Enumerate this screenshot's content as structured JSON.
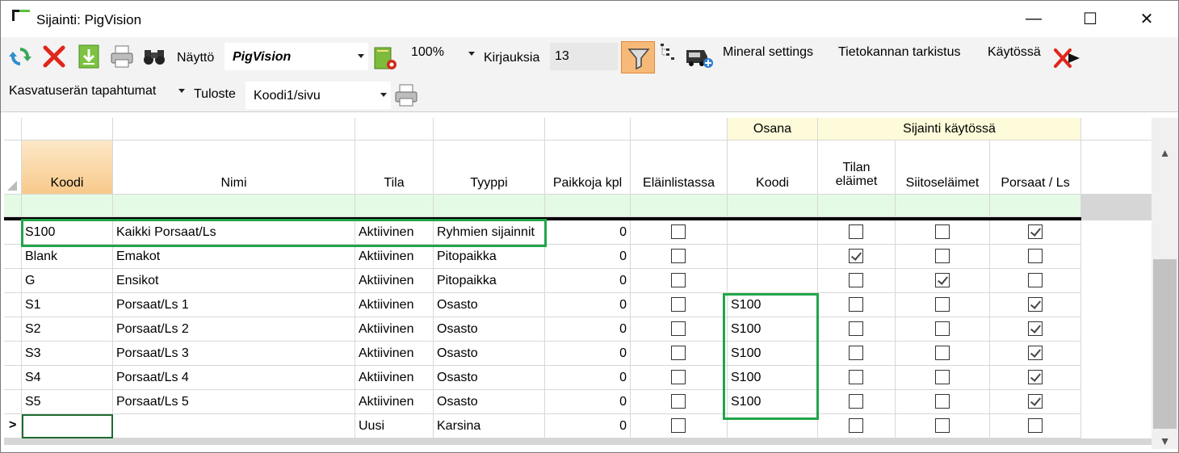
{
  "window": {
    "title": "Sijainti: PigVision",
    "minimize": "—",
    "maximize": "☐",
    "close": "✕"
  },
  "toolbar": {
    "nayto_label": "Näyttö",
    "nayto_value": "PigVision",
    "zoom_value": "100%",
    "kirjauksia_label": "Kirjauksia",
    "kirjauksia_value": "13",
    "mineral_settings": "Mineral settings",
    "tietokannan_tarkistus": "Tietokannan tarkistus",
    "kaytossa": "Käytössä",
    "kasvatuseran_tapahtumat": "Kasvatuserän tapahtumat",
    "tuloste_label": "Tuloste",
    "tuloste_value": "Koodi1/sivu"
  },
  "grid": {
    "group_headers": {
      "osana": "Osana",
      "sijainti_kaytossa": "Sijainti käytössä"
    },
    "columns": {
      "koodi": "Koodi",
      "nimi": "Nimi",
      "tila": "Tila",
      "tyyppi": "Tyyppi",
      "paikkoja": "Paikkoja kpl",
      "elainlistassa": "Eläinlistassa",
      "osana_koodi": "Koodi",
      "tilan_elaimet_1": "Tilan",
      "tilan_elaimet_2": "eläimet",
      "siitoselaimet": "Siitoseläimet",
      "porsaat_ls": "Porsaat / Ls"
    },
    "rows": [
      {
        "koodi": "S100",
        "nimi": "Kaikki Porsaat/Ls",
        "tila": "Aktiivinen",
        "tyyppi": "Ryhmien sijainnit",
        "paikkoja": "0",
        "elainlistassa": false,
        "osana": "",
        "tilan": false,
        "siitos": false,
        "porsaat": true
      },
      {
        "koodi": "Blank",
        "nimi": "Emakot",
        "tila": "Aktiivinen",
        "tyyppi": "Pitopaikka",
        "paikkoja": "0",
        "elainlistassa": false,
        "osana": "",
        "tilan": true,
        "siitos": false,
        "porsaat": false
      },
      {
        "koodi": "G",
        "nimi": "Ensikot",
        "tila": "Aktiivinen",
        "tyyppi": "Pitopaikka",
        "paikkoja": "0",
        "elainlistassa": false,
        "osana": "",
        "tilan": false,
        "siitos": true,
        "porsaat": false
      },
      {
        "koodi": "S1",
        "nimi": "Porsaat/Ls 1",
        "tila": "Aktiivinen",
        "tyyppi": "Osasto",
        "paikkoja": "0",
        "elainlistassa": false,
        "osana": "S100",
        "tilan": false,
        "siitos": false,
        "porsaat": true
      },
      {
        "koodi": "S2",
        "nimi": "Porsaat/Ls 2",
        "tila": "Aktiivinen",
        "tyyppi": "Osasto",
        "paikkoja": "0",
        "elainlistassa": false,
        "osana": "S100",
        "tilan": false,
        "siitos": false,
        "porsaat": true
      },
      {
        "koodi": "S3",
        "nimi": "Porsaat/Ls 3",
        "tila": "Aktiivinen",
        "tyyppi": "Osasto",
        "paikkoja": "0",
        "elainlistassa": false,
        "osana": "S100",
        "tilan": false,
        "siitos": false,
        "porsaat": true
      },
      {
        "koodi": "S4",
        "nimi": "Porsaat/Ls 4",
        "tila": "Aktiivinen",
        "tyyppi": "Osasto",
        "paikkoja": "0",
        "elainlistassa": false,
        "osana": "S100",
        "tilan": false,
        "siitos": false,
        "porsaat": true
      },
      {
        "koodi": "S5",
        "nimi": "Porsaat/Ls 5",
        "tila": "Aktiivinen",
        "tyyppi": "Osasto",
        "paikkoja": "0",
        "elainlistassa": false,
        "osana": "S100",
        "tilan": false,
        "siitos": false,
        "porsaat": true
      }
    ],
    "new_row": {
      "marker": ">",
      "koodi": "",
      "nimi": "",
      "tila": "Uusi",
      "tyyppi": "Karsina",
      "paikkoja": "0",
      "elainlistassa": false,
      "osana": "",
      "tilan": false,
      "siitos": false,
      "porsaat": false
    }
  },
  "colors": {
    "highlight_box": "#21a64a",
    "group_header_bg": "#fdfbd9",
    "filter_row_bg": "#e4fae4",
    "selected_header": "#f7c98a"
  }
}
